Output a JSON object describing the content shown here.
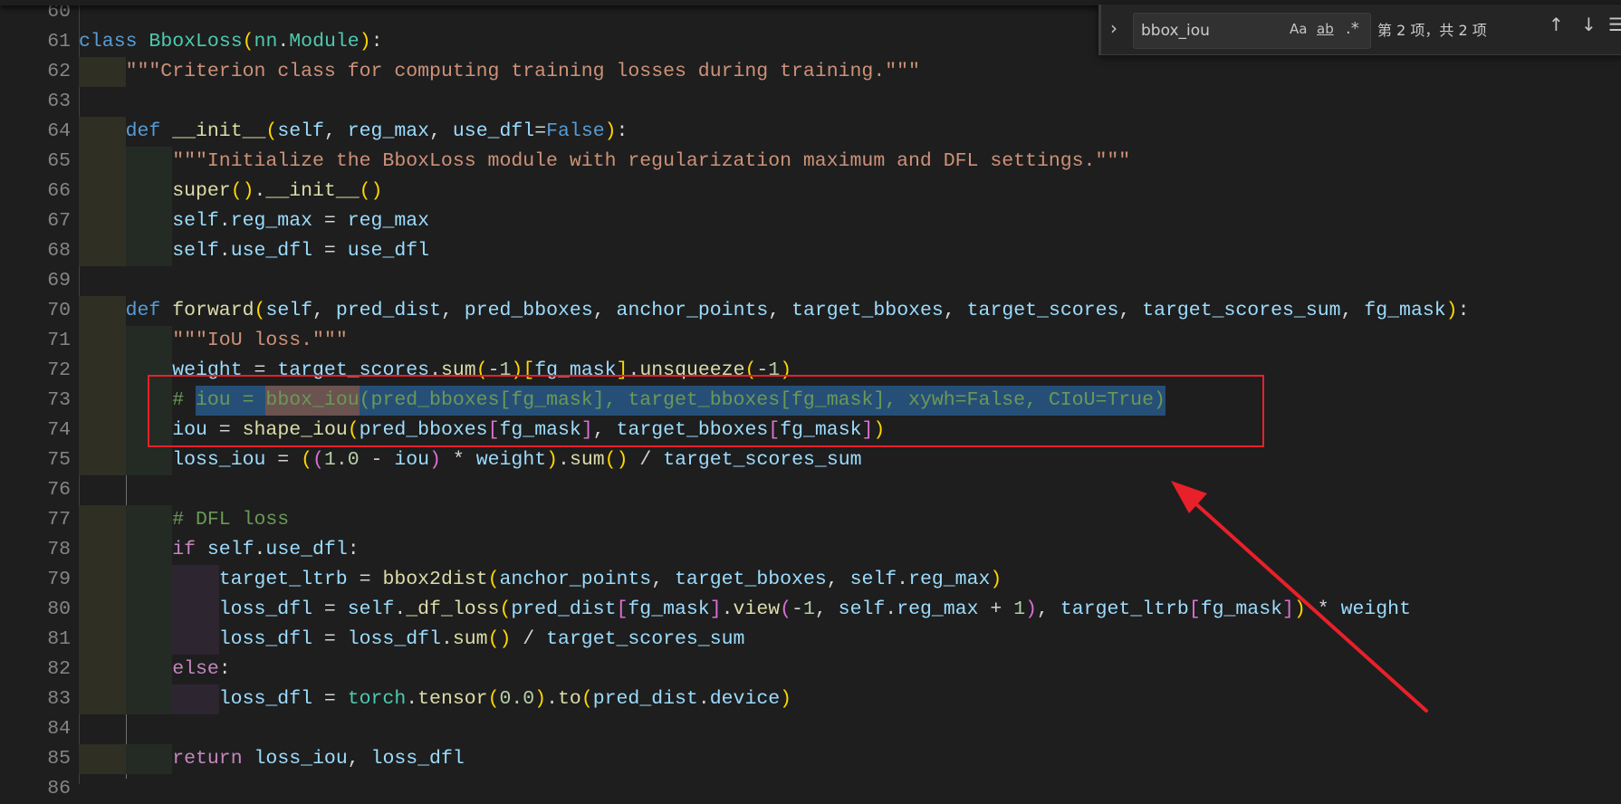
{
  "find_widget": {
    "query": "bbox_iou",
    "match_case_label": "Aa",
    "whole_word_label": "ab",
    "regex_label": ".*",
    "result_count": "第 2 项，共 2 项",
    "toggle_icon": "chevron-right-icon",
    "prev_icon": "arrow-up-icon",
    "next_icon": "arrow-down-icon",
    "menu_icon": "menu-icon"
  },
  "colors": {
    "annotation": "#e8202a",
    "selection": "#264f78",
    "find_match": "#6b5350"
  },
  "editor": {
    "lines": [
      {
        "n": "60",
        "indent": 0,
        "tokens": []
      },
      {
        "n": "61",
        "indent": 0,
        "tokens": [
          [
            "class ",
            "k"
          ],
          [
            "BboxLoss",
            "t"
          ],
          [
            "(",
            "b1"
          ],
          [
            "nn",
            "t"
          ],
          [
            ".",
            "p"
          ],
          [
            "Module",
            "t"
          ],
          [
            ")",
            "b1"
          ],
          [
            ":",
            "p"
          ]
        ]
      },
      {
        "n": "62",
        "indent": 1,
        "tokens": [
          [
            "\"\"\"Criterion class for computing training losses during training.\"\"\"",
            "s"
          ]
        ]
      },
      {
        "n": "63",
        "indent": 0,
        "tokens": []
      },
      {
        "n": "64",
        "indent": 1,
        "tokens": [
          [
            "def ",
            "k"
          ],
          [
            "__init__",
            "f"
          ],
          [
            "(",
            "b1"
          ],
          [
            "self",
            "v"
          ],
          [
            ", ",
            "p"
          ],
          [
            "reg_max",
            "v"
          ],
          [
            ", ",
            "p"
          ],
          [
            "use_dfl",
            "v"
          ],
          [
            "=",
            "p"
          ],
          [
            "False",
            "k"
          ],
          [
            ")",
            "b1"
          ],
          [
            ":",
            "p"
          ]
        ]
      },
      {
        "n": "65",
        "indent": 2,
        "tokens": [
          [
            "\"\"\"Initialize the BboxLoss module with regularization maximum and DFL settings.\"\"\"",
            "s"
          ]
        ]
      },
      {
        "n": "66",
        "indent": 2,
        "tokens": [
          [
            "super",
            "f"
          ],
          [
            "()",
            "b1"
          ],
          [
            ".",
            "p"
          ],
          [
            "__init__",
            "f"
          ],
          [
            "()",
            "b1"
          ]
        ]
      },
      {
        "n": "67",
        "indent": 2,
        "tokens": [
          [
            "self",
            "v"
          ],
          [
            ".",
            "p"
          ],
          [
            "reg_max",
            "v"
          ],
          [
            " = ",
            "p"
          ],
          [
            "reg_max",
            "v"
          ]
        ]
      },
      {
        "n": "68",
        "indent": 2,
        "tokens": [
          [
            "self",
            "v"
          ],
          [
            ".",
            "p"
          ],
          [
            "use_dfl",
            "v"
          ],
          [
            " = ",
            "p"
          ],
          [
            "use_dfl",
            "v"
          ]
        ]
      },
      {
        "n": "69",
        "indent": 0,
        "tokens": []
      },
      {
        "n": "70",
        "indent": 1,
        "tokens": [
          [
            "def ",
            "k"
          ],
          [
            "forward",
            "f"
          ],
          [
            "(",
            "b1"
          ],
          [
            "self",
            "v"
          ],
          [
            ", ",
            "p"
          ],
          [
            "pred_dist",
            "v"
          ],
          [
            ", ",
            "p"
          ],
          [
            "pred_bboxes",
            "v"
          ],
          [
            ", ",
            "p"
          ],
          [
            "anchor_points",
            "v"
          ],
          [
            ", ",
            "p"
          ],
          [
            "target_bboxes",
            "v"
          ],
          [
            ", ",
            "p"
          ],
          [
            "target_scores",
            "v"
          ],
          [
            ", ",
            "p"
          ],
          [
            "target_scores_sum",
            "v"
          ],
          [
            ", ",
            "p"
          ],
          [
            "fg_mask",
            "v"
          ],
          [
            ")",
            "b1"
          ],
          [
            ":",
            "p"
          ]
        ]
      },
      {
        "n": "71",
        "indent": 2,
        "tokens": [
          [
            "\"\"\"IoU loss.\"\"\"",
            "s"
          ]
        ]
      },
      {
        "n": "72",
        "indent": 2,
        "tokens": [
          [
            "weight",
            "v"
          ],
          [
            " = ",
            "p"
          ],
          [
            "target_scores",
            "v"
          ],
          [
            ".",
            "p"
          ],
          [
            "sum",
            "f"
          ],
          [
            "(",
            "b1"
          ],
          [
            "-",
            "p"
          ],
          [
            "1",
            "n"
          ],
          [
            ")",
            "b1"
          ],
          [
            "[",
            "b1"
          ],
          [
            "fg_mask",
            "v"
          ],
          [
            "]",
            "b1"
          ],
          [
            ".",
            "p"
          ],
          [
            "unsqueeze",
            "f"
          ],
          [
            "(",
            "b1"
          ],
          [
            "-",
            "p"
          ],
          [
            "1",
            "n"
          ],
          [
            ")",
            "b1"
          ]
        ]
      },
      {
        "n": "73",
        "indent": 2,
        "tokens": [
          [
            "# ",
            "m"
          ],
          [
            "iou = ",
            "m sel"
          ],
          [
            "bbox_iou",
            "m match"
          ],
          [
            "(pred_bboxes[fg_mask], target_bboxes[fg_mask], xywh=False, CIoU=True)",
            "m sel"
          ]
        ]
      },
      {
        "n": "74",
        "indent": 2,
        "tokens": [
          [
            "iou",
            "v"
          ],
          [
            " = ",
            "p"
          ],
          [
            "shape_iou",
            "f"
          ],
          [
            "(",
            "b1"
          ],
          [
            "pred_bboxes",
            "v"
          ],
          [
            "[",
            "b2"
          ],
          [
            "fg_mask",
            "v"
          ],
          [
            "]",
            "b2"
          ],
          [
            ", ",
            "p"
          ],
          [
            "target_bboxes",
            "v"
          ],
          [
            "[",
            "b2"
          ],
          [
            "fg_mask",
            "v"
          ],
          [
            "]",
            "b2"
          ],
          [
            ")",
            "b1"
          ]
        ]
      },
      {
        "n": "75",
        "indent": 2,
        "tokens": [
          [
            "loss_iou",
            "v"
          ],
          [
            " = ",
            "p"
          ],
          [
            "(",
            "b1"
          ],
          [
            "(",
            "b2"
          ],
          [
            "1.0",
            "n"
          ],
          [
            " - ",
            "p"
          ],
          [
            "iou",
            "v"
          ],
          [
            ")",
            "b2"
          ],
          [
            " * ",
            "p"
          ],
          [
            "weight",
            "v"
          ],
          [
            ")",
            "b1"
          ],
          [
            ".",
            "p"
          ],
          [
            "sum",
            "f"
          ],
          [
            "()",
            "b1"
          ],
          [
            " / ",
            "p"
          ],
          [
            "target_scores_sum",
            "v"
          ]
        ]
      },
      {
        "n": "76",
        "indent": 0,
        "tokens": []
      },
      {
        "n": "77",
        "indent": 2,
        "tokens": [
          [
            "# DFL loss",
            "m"
          ]
        ]
      },
      {
        "n": "78",
        "indent": 2,
        "tokens": [
          [
            "if",
            "c"
          ],
          [
            " ",
            "p"
          ],
          [
            "self",
            "v"
          ],
          [
            ".",
            "p"
          ],
          [
            "use_dfl",
            "v"
          ],
          [
            ":",
            "p"
          ]
        ]
      },
      {
        "n": "79",
        "indent": 3,
        "tokens": [
          [
            "target_ltrb",
            "v"
          ],
          [
            " = ",
            "p"
          ],
          [
            "bbox2dist",
            "f"
          ],
          [
            "(",
            "b1"
          ],
          [
            "anchor_points",
            "v"
          ],
          [
            ", ",
            "p"
          ],
          [
            "target_bboxes",
            "v"
          ],
          [
            ", ",
            "p"
          ],
          [
            "self",
            "v"
          ],
          [
            ".",
            "p"
          ],
          [
            "reg_max",
            "v"
          ],
          [
            ")",
            "b1"
          ]
        ]
      },
      {
        "n": "80",
        "indent": 3,
        "tokens": [
          [
            "loss_dfl",
            "v"
          ],
          [
            " = ",
            "p"
          ],
          [
            "self",
            "v"
          ],
          [
            ".",
            "p"
          ],
          [
            "_df_loss",
            "f"
          ],
          [
            "(",
            "b1"
          ],
          [
            "pred_dist",
            "v"
          ],
          [
            "[",
            "b2"
          ],
          [
            "fg_mask",
            "v"
          ],
          [
            "]",
            "b2"
          ],
          [
            ".",
            "p"
          ],
          [
            "view",
            "f"
          ],
          [
            "(",
            "b2"
          ],
          [
            "-",
            "p"
          ],
          [
            "1",
            "n"
          ],
          [
            ", ",
            "p"
          ],
          [
            "self",
            "v"
          ],
          [
            ".",
            "p"
          ],
          [
            "reg_max",
            "v"
          ],
          [
            " + ",
            "p"
          ],
          [
            "1",
            "n"
          ],
          [
            ")",
            "b2"
          ],
          [
            ", ",
            "p"
          ],
          [
            "target_ltrb",
            "v"
          ],
          [
            "[",
            "b2"
          ],
          [
            "fg_mask",
            "v"
          ],
          [
            "]",
            "b2"
          ],
          [
            ")",
            "b1"
          ],
          [
            " * ",
            "p"
          ],
          [
            "weight",
            "v"
          ]
        ]
      },
      {
        "n": "81",
        "indent": 3,
        "tokens": [
          [
            "loss_dfl",
            "v"
          ],
          [
            " = ",
            "p"
          ],
          [
            "loss_dfl",
            "v"
          ],
          [
            ".",
            "p"
          ],
          [
            "sum",
            "f"
          ],
          [
            "()",
            "b1"
          ],
          [
            " / ",
            "p"
          ],
          [
            "target_scores_sum",
            "v"
          ]
        ]
      },
      {
        "n": "82",
        "indent": 2,
        "tokens": [
          [
            "else",
            "c"
          ],
          [
            ":",
            "p"
          ]
        ]
      },
      {
        "n": "83",
        "indent": 3,
        "tokens": [
          [
            "loss_dfl",
            "v"
          ],
          [
            " = ",
            "p"
          ],
          [
            "torch",
            "t"
          ],
          [
            ".",
            "p"
          ],
          [
            "tensor",
            "f"
          ],
          [
            "(",
            "b1"
          ],
          [
            "0.0",
            "n"
          ],
          [
            ")",
            "b1"
          ],
          [
            ".",
            "p"
          ],
          [
            "to",
            "f"
          ],
          [
            "(",
            "b1"
          ],
          [
            "pred_dist",
            "v"
          ],
          [
            ".",
            "p"
          ],
          [
            "device",
            "v"
          ],
          [
            ")",
            "b1"
          ]
        ]
      },
      {
        "n": "84",
        "indent": 0,
        "tokens": []
      },
      {
        "n": "85",
        "indent": 2,
        "tokens": [
          [
            "return",
            "c"
          ],
          [
            " ",
            "p"
          ],
          [
            "loss_iou",
            "v"
          ],
          [
            ", ",
            "p"
          ],
          [
            "loss_dfl",
            "v"
          ]
        ]
      },
      {
        "n": "86",
        "indent": 0,
        "tokens": []
      }
    ]
  }
}
